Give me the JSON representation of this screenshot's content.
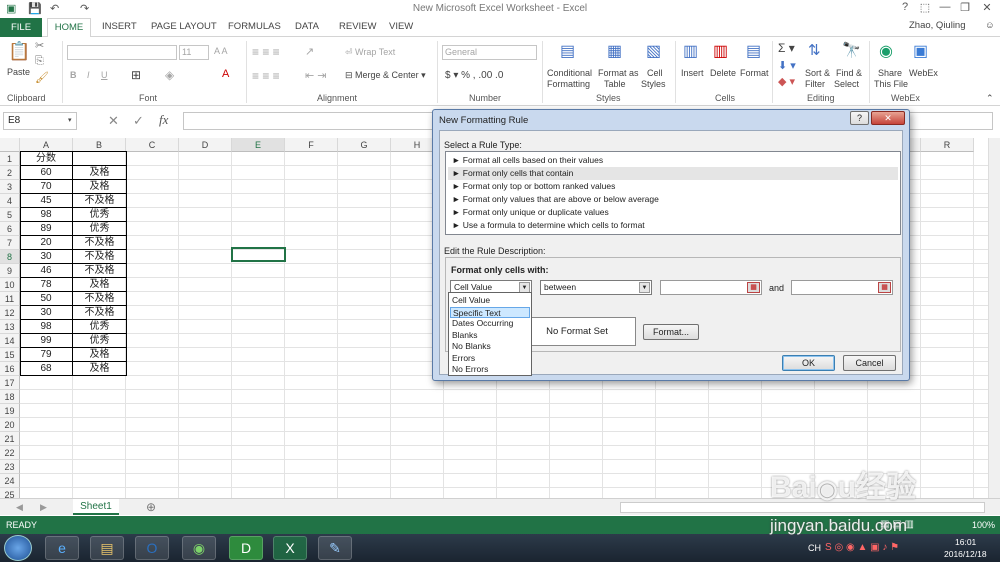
{
  "window": {
    "title": "New Microsoft Excel Worksheet - Excel",
    "user": "Zhao, Qiuling",
    "help": "?"
  },
  "tabs": [
    "FILE",
    "HOME",
    "INSERT",
    "PAGE LAYOUT",
    "FORMULAS",
    "DATA",
    "REVIEW",
    "VIEW"
  ],
  "ribbon": {
    "paste": "Paste",
    "clipboard": "Clipboard",
    "font_name": "",
    "font_size": "11",
    "font": "Font",
    "wrap_text": "Wrap Text",
    "merge_center": "Merge & Center",
    "alignment": "Alignment",
    "number_format": "General",
    "number": "Number",
    "cond_fmt_1": "Conditional",
    "cond_fmt_2": "Formatting",
    "fmt_table_1": "Format as",
    "fmt_table_2": "Table",
    "cell_styles_1": "Cell",
    "cell_styles_2": "Styles",
    "styles": "Styles",
    "insert": "Insert",
    "delete": "Delete",
    "format": "Format",
    "cells": "Cells",
    "sort_1": "Sort &",
    "sort_2": "Filter",
    "find_1": "Find &",
    "find_2": "Select",
    "editing": "Editing",
    "share_1": "Share",
    "share_2": "This File",
    "webex": "WebEx",
    "webex_group": "WebEx"
  },
  "namebox": "E8",
  "fx": "fx",
  "columns": [
    "A",
    "B",
    "C",
    "D",
    "E",
    "F",
    "G",
    "H",
    "I",
    "J",
    "K",
    "L",
    "M",
    "N",
    "O",
    "P",
    "Q",
    "R"
  ],
  "rows": [
    [
      "分数",
      ""
    ],
    [
      "60",
      "及格"
    ],
    [
      "70",
      "及格"
    ],
    [
      "45",
      "不及格"
    ],
    [
      "98",
      "优秀"
    ],
    [
      "89",
      "优秀"
    ],
    [
      "20",
      "不及格"
    ],
    [
      "30",
      "不及格"
    ],
    [
      "46",
      "不及格"
    ],
    [
      "78",
      "及格"
    ],
    [
      "50",
      "不及格"
    ],
    [
      "30",
      "不及格"
    ],
    [
      "98",
      "优秀"
    ],
    [
      "99",
      "优秀"
    ],
    [
      "79",
      "及格"
    ],
    [
      "68",
      "及格"
    ]
  ],
  "row_numbers": [
    "1",
    "2",
    "3",
    "4",
    "5",
    "6",
    "7",
    "8",
    "9",
    "10",
    "11",
    "12",
    "13",
    "14",
    "15",
    "16",
    "17",
    "18",
    "19",
    "20",
    "21",
    "22",
    "23",
    "24",
    "25"
  ],
  "sheet_tab": "Sheet1",
  "status": {
    "ready": "READY",
    "zoom": "100%"
  },
  "taskbar": {
    "ime": "CH",
    "time": "16:01",
    "date": "2016/12/18"
  },
  "dialog": {
    "title": "New Formatting Rule",
    "select_label": "Select a Rule Type:",
    "rule_types": [
      "► Format all cells based on their values",
      "► Format only cells that contain",
      "► Format only top or bottom ranked values",
      "► Format only values that are above or below average",
      "► Format only unique or duplicate values",
      "► Use a formula to determine which cells to format"
    ],
    "edit_label": "Edit the Rule Description:",
    "format_only": "Format only cells with:",
    "combo1": "Cell Value",
    "combo2": "between",
    "and": "and",
    "preview": "No Format Set",
    "format_btn": "Format...",
    "ok": "OK",
    "cancel": "Cancel",
    "dropdown": [
      "Cell Value",
      "Specific Text",
      "Dates Occurring",
      "Blanks",
      "No Blanks",
      "Errors",
      "No Errors"
    ]
  },
  "watermark": {
    "logo": "Baidu经验",
    "url": "jingyan.baidu.com"
  }
}
